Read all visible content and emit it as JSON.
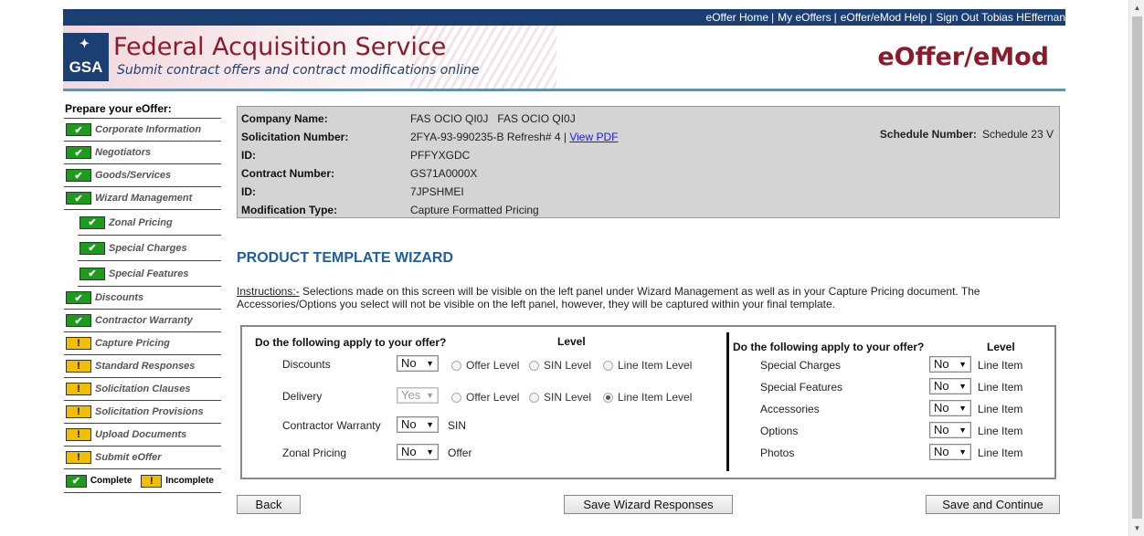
{
  "topnav": {
    "links": [
      "eOffer Home",
      "My eOffers",
      "eOffer/eMod Help",
      "Sign Out Tobias HEffernan"
    ],
    "separator": "|"
  },
  "header": {
    "logo_text": "GSA",
    "agency": "Federal Acquisition Service",
    "tagline": "Submit contract offers and contract modifications online",
    "product": "eOffer/eMod"
  },
  "sidebar": {
    "title": "Prepare your eOffer:",
    "items": [
      {
        "label": "Corporate Information",
        "status": "complete"
      },
      {
        "label": "Negotiators",
        "status": "complete"
      },
      {
        "label": "Goods/Services",
        "status": "complete"
      },
      {
        "label": "Wizard Management",
        "status": "complete"
      },
      {
        "label": "Zonal Pricing",
        "status": "complete"
      },
      {
        "label": "Special Charges",
        "status": "complete"
      },
      {
        "label": "Special Features",
        "status": "complete"
      },
      {
        "label": "Discounts",
        "status": "complete"
      },
      {
        "label": "Contractor Warranty",
        "status": "complete"
      },
      {
        "label": "Capture Pricing",
        "status": "incomplete"
      },
      {
        "label": "Standard Responses",
        "status": "incomplete"
      },
      {
        "label": "Solicitation Clauses",
        "status": "incomplete"
      },
      {
        "label": "Solicitation Provisions",
        "status": "incomplete"
      },
      {
        "label": "Upload Documents",
        "status": "incomplete"
      },
      {
        "label": "Submit eOffer",
        "status": "incomplete"
      }
    ],
    "legend": {
      "complete": "Complete",
      "incomplete": "Incomplete"
    },
    "icons": {
      "complete": "✔",
      "incomplete": "!"
    }
  },
  "info": {
    "company_label": "Company Name:",
    "company_value": "FAS OCIO QI0J   FAS OCIO QI0J",
    "solicitation_label": "Solicitation Number:",
    "solicitation_value": "2FYA-93-990235-B Refresh# 4 |",
    "view_pdf": "View PDF",
    "id1_label": "ID:",
    "id1_value": "PFFYXGDC",
    "contract_label": "Contract Number:",
    "contract_value": "GS71A0000X",
    "id2_label": "ID:",
    "id2_value": "7JPSHMEI",
    "modtype_label": "Modification Type:",
    "modtype_value": "Capture Formatted Pricing",
    "schedule_label": "Schedule Number:",
    "schedule_value": "Schedule 23 V"
  },
  "wizard": {
    "title": "PRODUCT TEMPLATE WIZARD",
    "instructions_label": "Instructions:-",
    "instructions_text": " Selections made on this screen will be visible on the left panel under Wizard Management as well as in your Capture Pricing document. The Accessories/Options you select will not be visible on the left panel, however, they will be captured within your final template.",
    "question": "Do the following apply to your offer?",
    "level_header": "Level",
    "left_rows": {
      "discounts": {
        "label": "Discounts",
        "value": "No"
      },
      "delivery": {
        "label": "Delivery",
        "value": "Yes"
      },
      "warranty": {
        "label": "Contractor Warranty",
        "value": "No",
        "level": "SIN"
      },
      "zonal": {
        "label": "Zonal Pricing",
        "value": "No",
        "level": "Offer"
      }
    },
    "radio_labels": {
      "offer": "Offer Level",
      "sin": "SIN Level",
      "line": "Line Item Level"
    },
    "right_rows": [
      {
        "label": "Special Charges",
        "value": "No",
        "level": "Line Item"
      },
      {
        "label": "Special Features",
        "value": "No",
        "level": "Line Item"
      },
      {
        "label": "Accessories",
        "value": "No",
        "level": "Line Item"
      },
      {
        "label": "Options",
        "value": "No",
        "level": "Line Item"
      },
      {
        "label": "Photos",
        "value": "No",
        "level": "Line Item"
      }
    ]
  },
  "buttons": {
    "back": "Back",
    "save": "Save Wizard Responses",
    "save_continue": "Save and Continue"
  }
}
